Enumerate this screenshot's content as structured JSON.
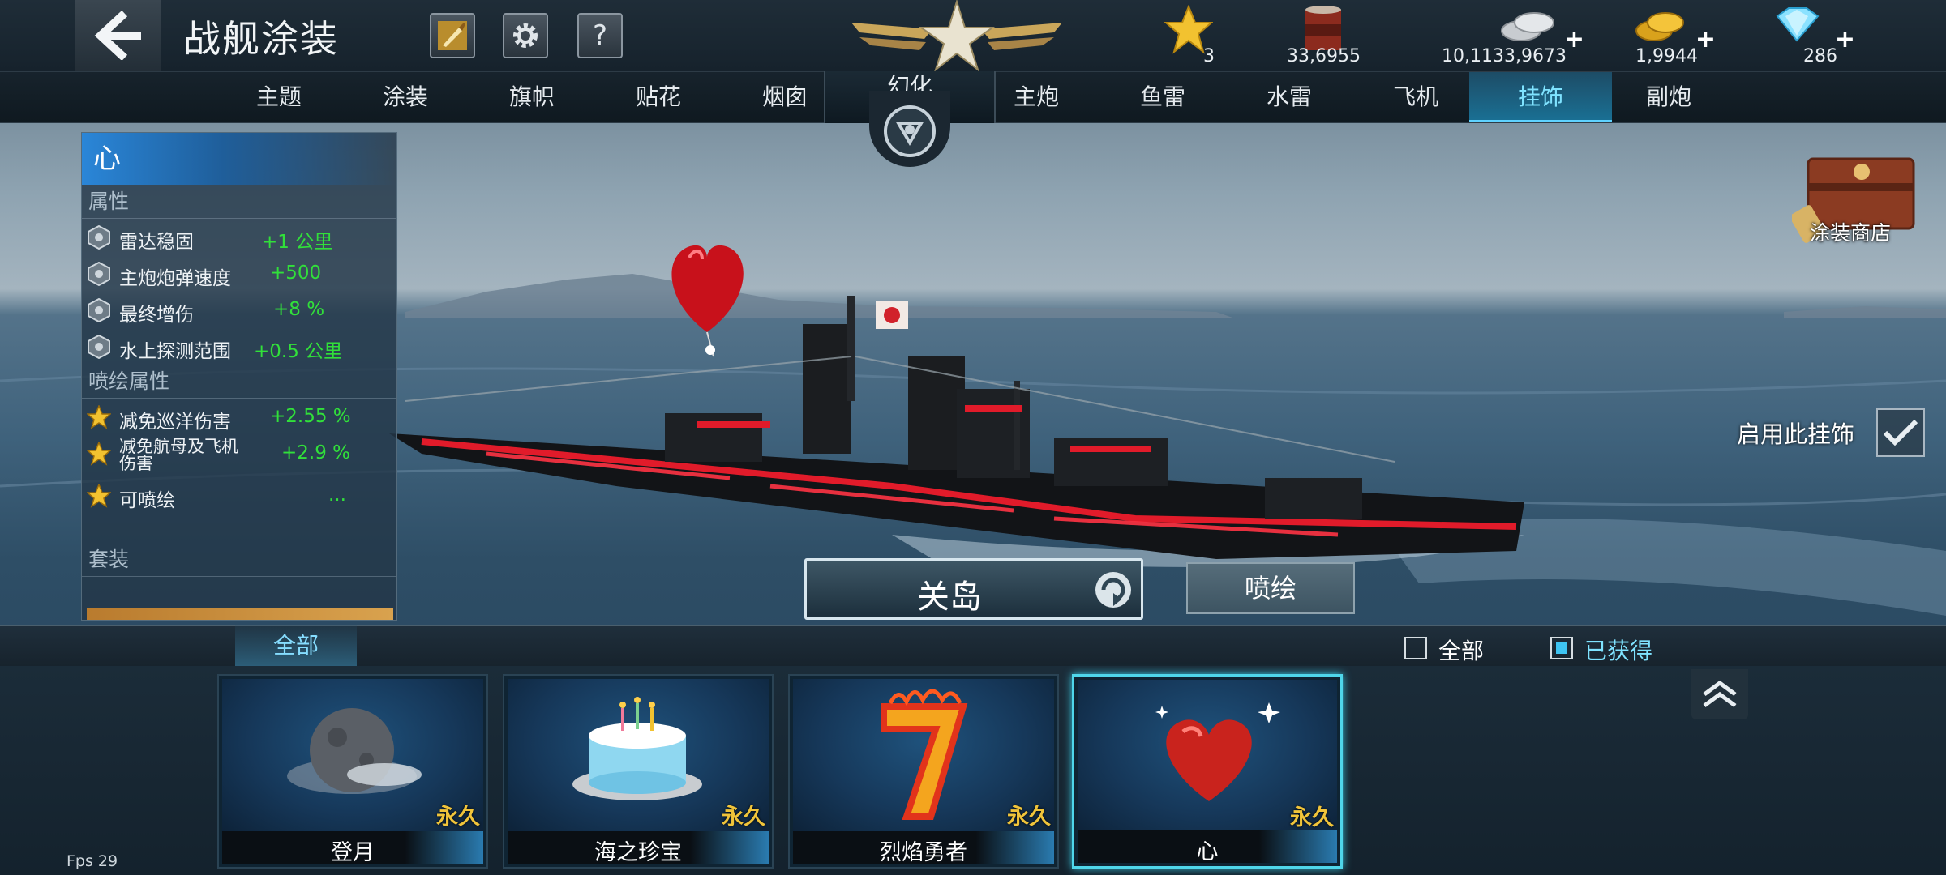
{
  "header": {
    "title": "战舰涂装",
    "help_label": "?"
  },
  "resources": {
    "stars": "3",
    "paint": "33,6955",
    "silver": "10,1133,9673",
    "gold": "1,9944",
    "diamond": "286",
    "plus": "+"
  },
  "tabs": {
    "items": [
      "主题",
      "涂装",
      "旗帜",
      "贴花",
      "烟囱"
    ],
    "center": "幻化",
    "items_right": [
      "主炮",
      "鱼雷",
      "水雷",
      "飞机",
      "挂饰",
      "副炮"
    ],
    "active": "挂饰"
  },
  "attributes": {
    "header": "心",
    "section_props": "属性",
    "props": [
      {
        "name": "雷达稳固",
        "value": "+1 公里"
      },
      {
        "name": "主炮炮弹速度",
        "value": "+500"
      },
      {
        "name": "最终增伤",
        "value": "+8 %"
      },
      {
        "name": "水上探测范围",
        "value": "+0.5 公里"
      }
    ],
    "section_paint": "喷绘属性",
    "paint_props": [
      {
        "name": "减免巡洋伤害",
        "value": "+2.55 %"
      },
      {
        "name": "减免航母及飞机伤害",
        "value": "+2.9 %"
      },
      {
        "name": "可喷绘",
        "value": "..."
      }
    ],
    "section_set": "套装"
  },
  "right": {
    "shop_label": "涂装商店",
    "use_accessory_label": "启用此挂饰"
  },
  "ship": {
    "name": "关岛",
    "paint_label": "喷绘"
  },
  "filter": {
    "category": "全部",
    "show_all": "全部",
    "owned": "已获得"
  },
  "items": [
    {
      "name": "登月",
      "tag": "永久"
    },
    {
      "name": "海之珍宝",
      "tag": "永久"
    },
    {
      "name": "烈焰勇者",
      "tag": "永久"
    },
    {
      "name": "心",
      "tag": "永久"
    }
  ],
  "fps": "Fps 29",
  "colors": {
    "accent": "#5fd2ff",
    "positive": "#31e03a",
    "tag": "#f0c43a",
    "ship_stripe": "#e11b2a"
  }
}
